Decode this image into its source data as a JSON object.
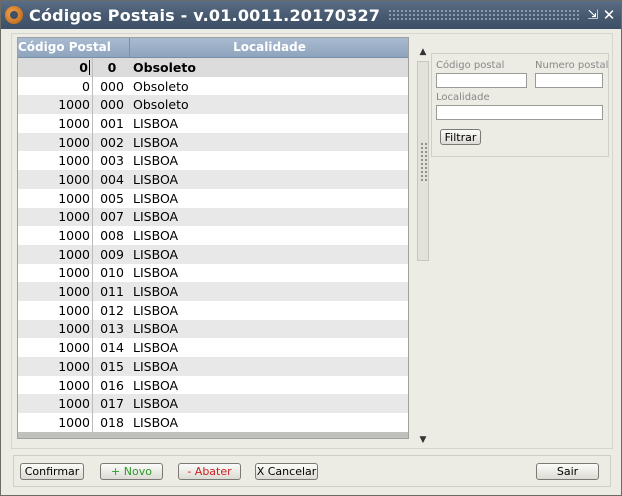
{
  "window": {
    "title": "Códigos Postais - v.01.0011.20170327",
    "minimize_glyph": "⇲",
    "close_glyph": "✕"
  },
  "grid": {
    "columns": [
      "Código Postal",
      "Localidade"
    ],
    "rows": [
      {
        "cp4": "0",
        "cp3": "0",
        "localidade": "Obsoleto"
      },
      {
        "cp4": "0",
        "cp3": "000",
        "localidade": "Obsoleto"
      },
      {
        "cp4": "1000",
        "cp3": "000",
        "localidade": "Obsoleto"
      },
      {
        "cp4": "1000",
        "cp3": "001",
        "localidade": "LISBOA"
      },
      {
        "cp4": "1000",
        "cp3": "002",
        "localidade": "LISBOA"
      },
      {
        "cp4": "1000",
        "cp3": "003",
        "localidade": "LISBOA"
      },
      {
        "cp4": "1000",
        "cp3": "004",
        "localidade": "LISBOA"
      },
      {
        "cp4": "1000",
        "cp3": "005",
        "localidade": "LISBOA"
      },
      {
        "cp4": "1000",
        "cp3": "007",
        "localidade": "LISBOA"
      },
      {
        "cp4": "1000",
        "cp3": "008",
        "localidade": "LISBOA"
      },
      {
        "cp4": "1000",
        "cp3": "009",
        "localidade": "LISBOA"
      },
      {
        "cp4": "1000",
        "cp3": "010",
        "localidade": "LISBOA"
      },
      {
        "cp4": "1000",
        "cp3": "011",
        "localidade": "LISBOA"
      },
      {
        "cp4": "1000",
        "cp3": "012",
        "localidade": "LISBOA"
      },
      {
        "cp4": "1000",
        "cp3": "013",
        "localidade": "LISBOA"
      },
      {
        "cp4": "1000",
        "cp3": "014",
        "localidade": "LISBOA"
      },
      {
        "cp4": "1000",
        "cp3": "015",
        "localidade": "LISBOA"
      },
      {
        "cp4": "1000",
        "cp3": "016",
        "localidade": "LISBOA"
      },
      {
        "cp4": "1000",
        "cp3": "017",
        "localidade": "LISBOA"
      },
      {
        "cp4": "1000",
        "cp3": "018",
        "localidade": "LISBOA"
      }
    ]
  },
  "filter": {
    "codigo_postal_label": "Código postal",
    "codigo_postal_value": "",
    "numero_postal_label": "Numero postal",
    "numero_postal_value": "",
    "localidade_label": "Localidade",
    "localidade_value": "",
    "filtrar_label": "Filtrar"
  },
  "actions": {
    "confirmar": "Confirmar",
    "novo": "+ Novo",
    "abater": "- Abater",
    "cancelar": "X Cancelar",
    "sair": "Sair"
  },
  "colors": {
    "titlebar": "#46596f",
    "header": "#8ea3bd",
    "novo": "#2a9b2a",
    "abater": "#d02020"
  }
}
